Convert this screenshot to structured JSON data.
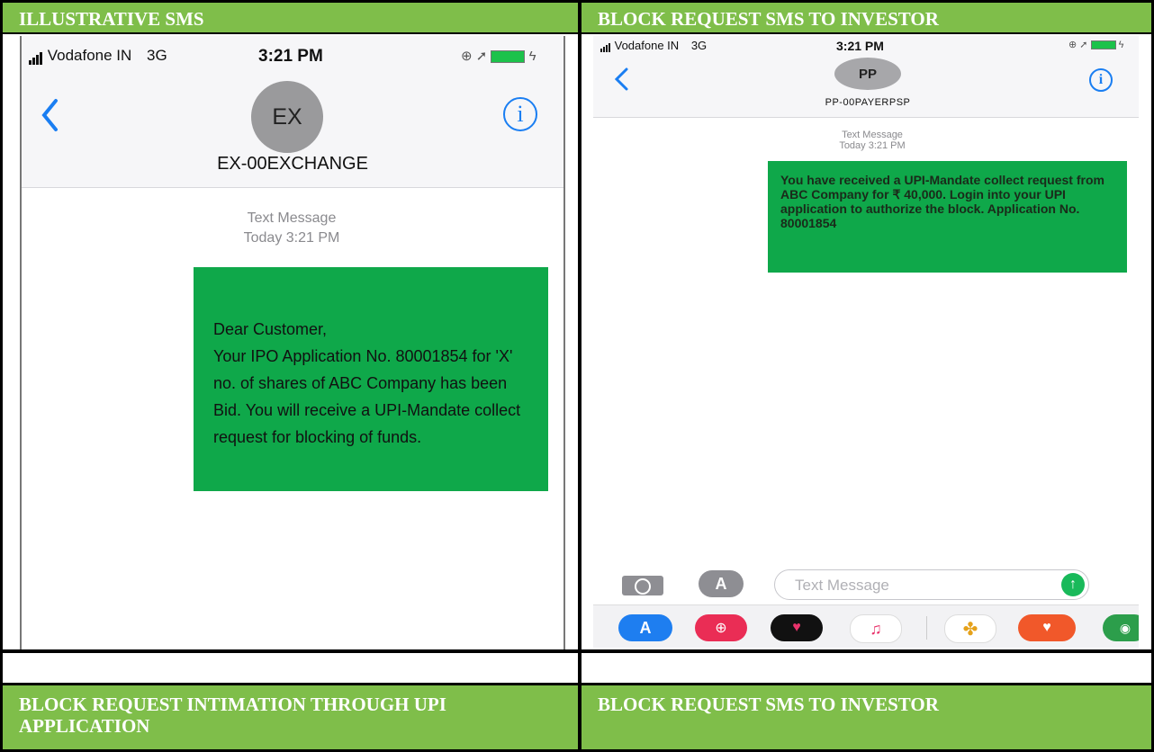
{
  "headers": {
    "top_left": "ILLUSTRATIVE SMS",
    "top_right": "BLOCK REQUEST SMS TO INVESTOR",
    "bottom_left": "BLOCK REQUEST INTIMATION THROUGH UPI APPLICATION",
    "bottom_right": "BLOCK REQUEST SMS TO INVESTOR"
  },
  "left_phone": {
    "carrier": "Vodafone IN",
    "network": "3G",
    "time": "3:21 PM",
    "avatar": "EX",
    "sender": "EX-00EXCHANGE",
    "stamp_label": "Text Message",
    "stamp_time": "Today 3:21 PM",
    "message": "Dear Customer,\nYour IPO Application No. 80001854 for 'X' no. of shares of ABC Company has been Bid. You will receive a UPI-Mandate collect request for blocking of funds."
  },
  "right_phone": {
    "carrier": "Vodafone IN",
    "network": "3G",
    "time": "3:21 PM",
    "avatar": "PP",
    "sender": "PP-00PAYERPSP",
    "stamp_label": "Text Message",
    "stamp_time": "Today 3:21 PM",
    "message": "You have received a UPI-Mandate collect request from ABC Company for ₹ 40,000. Login into your UPI application to authorize the block. Application No. 80001854",
    "input_placeholder": "Text Message"
  },
  "colors": {
    "header_green": "#7fbe4a",
    "bubble_green": "#0fa84a",
    "ios_blue": "#1a7ef2"
  },
  "icons": [
    "back-chevron-icon",
    "info-icon",
    "camera-icon",
    "app-store-icon",
    "send-icon",
    "search-app-icon",
    "heart-app-icon",
    "music-app-icon",
    "photos-app-icon",
    "music-memo-app-icon",
    "maps-app-icon"
  ]
}
